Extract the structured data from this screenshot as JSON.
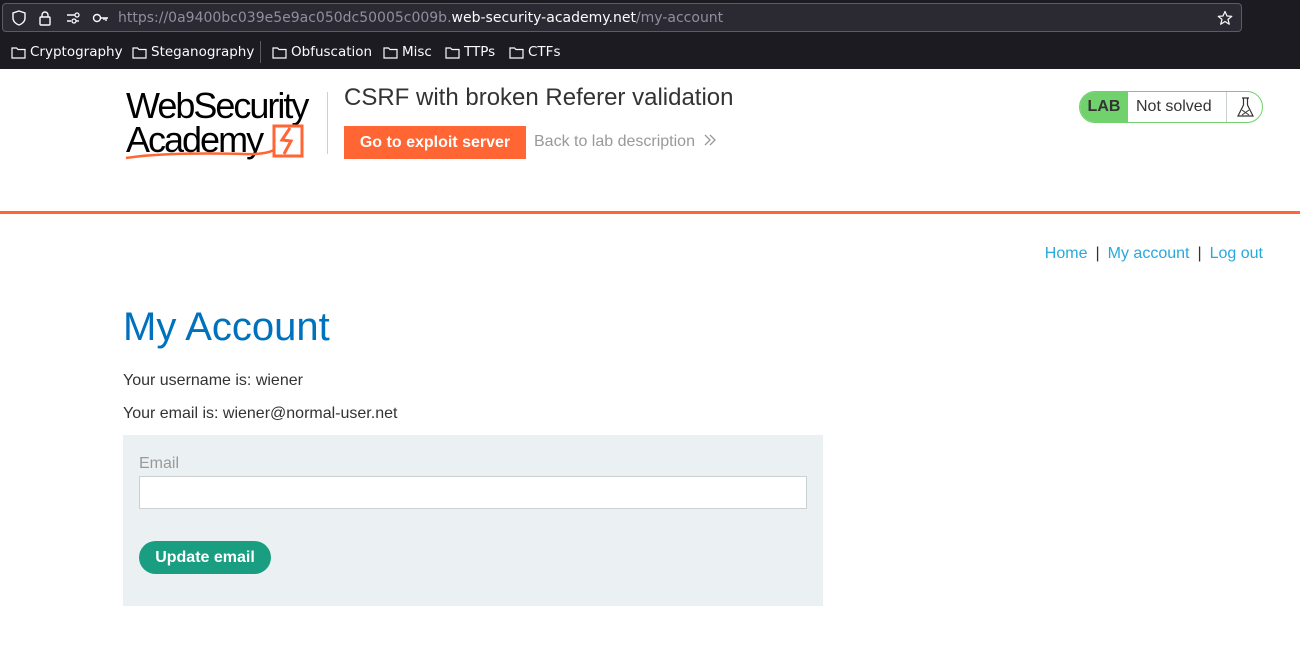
{
  "browser": {
    "url_prefix": "https://0a9400bc039e5e9ac050dc50005c009b.",
    "url_host": "web-security-academy.net",
    "url_path": "/my-account",
    "bookmarks": [
      "Cryptography",
      "Steganography",
      "Obfuscation",
      "Misc",
      "TTPs",
      "CTFs"
    ]
  },
  "header": {
    "logo_line1": "WebSecurity",
    "logo_line2": "Academy",
    "lab_title": "CSRF with broken Referer validation",
    "exploit_button": "Go to exploit server",
    "back_link": "Back to lab description",
    "lab_badge": {
      "label": "LAB",
      "status": "Not solved"
    }
  },
  "nav": {
    "home": "Home",
    "separator": "|",
    "my_account": "My account",
    "log_out": "Log out"
  },
  "main": {
    "heading": "My Account",
    "username_line": "Your username is: wiener",
    "email_line": "Your email is: wiener@normal-user.net",
    "form": {
      "email_label": "Email",
      "email_value": "",
      "submit_label": "Update email"
    }
  },
  "colors": {
    "accent": "#ff6633",
    "heading": "#0071bc",
    "link": "#29a8db",
    "button": "#1a9e81",
    "lab_green": "#70d16d"
  }
}
